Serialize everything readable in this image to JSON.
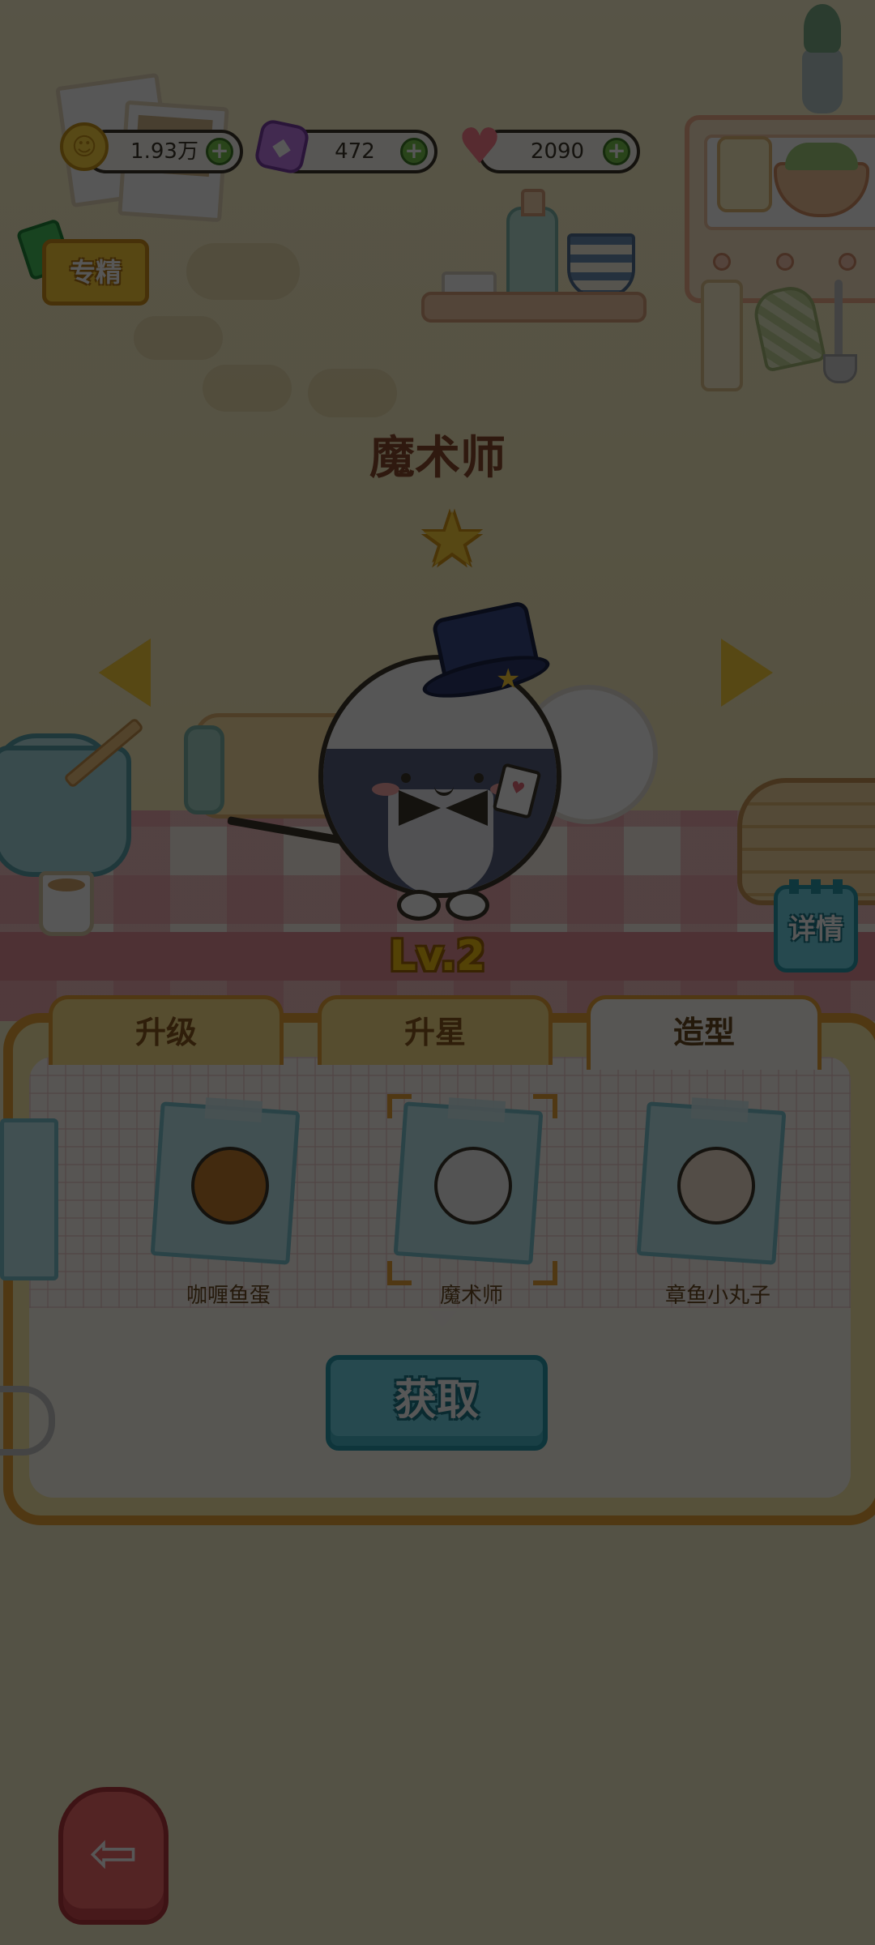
{
  "resources": {
    "coins": "1.93万",
    "gems": "472",
    "hearts": "2090"
  },
  "specialty_button": "专精",
  "character": {
    "name": "魔术师",
    "level": "Lv.2"
  },
  "detail_button": "详情",
  "tabs": [
    {
      "label": "升级",
      "active": false
    },
    {
      "label": "升星",
      "active": false
    },
    {
      "label": "造型",
      "active": true
    }
  ],
  "skins": [
    {
      "name": "咖喱鱼蛋",
      "selected": false
    },
    {
      "name": "魔术师",
      "selected": true
    },
    {
      "name": "章鱼小丸子",
      "selected": false
    }
  ],
  "get_button": "获取",
  "icons": {
    "coin": "coin-icon",
    "gem": "gem-icon",
    "heart": "heart-icon",
    "plus": "plus-icon",
    "left_arrow": "triangle-left-icon",
    "right_arrow": "triangle-right-icon",
    "star": "star-icon",
    "exit": "exit-arrow-icon"
  },
  "colors": {
    "accent_yellow": "#ffd23d",
    "button_teal": "#6fd6e6",
    "exit_red": "#f36a6a",
    "title_brown": "#8a4a2c"
  }
}
